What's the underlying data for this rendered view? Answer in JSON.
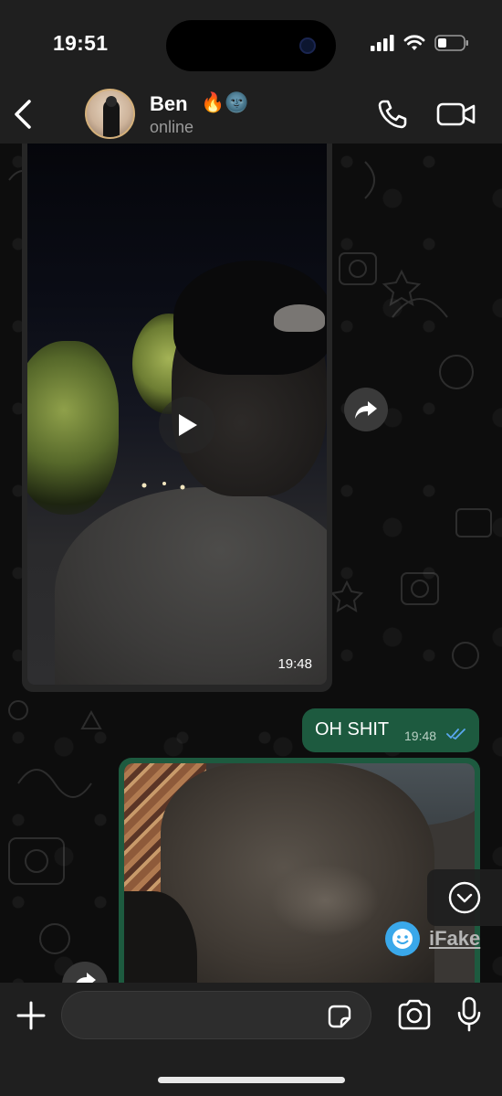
{
  "status_bar": {
    "time": "19:51",
    "icons": [
      "signal-icon",
      "wifi-icon",
      "battery-icon"
    ]
  },
  "header": {
    "back_icon": "chevron-left-icon",
    "contact_name": "Ben",
    "contact_emoji": "🔥🌚",
    "contact_status": "online",
    "call_icon": "phone-icon",
    "video_icon": "video-camera-icon"
  },
  "messages": {
    "incoming_video": {
      "time": "19:48",
      "play_icon": "play-icon",
      "forward_icon": "forward-icon"
    },
    "outgoing_text": {
      "text": "OH SHIT",
      "time": "19:48",
      "status_icon": "double-check-icon"
    },
    "outgoing_image": {
      "forward_icon": "forward-icon"
    }
  },
  "scroll_down_icon": "chevron-down-circle-icon",
  "watermark": {
    "text": "iFake"
  },
  "input_bar": {
    "plus_icon": "plus-icon",
    "placeholder": "",
    "sticker_icon": "sticker-icon",
    "camera_icon": "camera-icon",
    "mic_icon": "microphone-icon"
  },
  "colors": {
    "outgoing_bubble": "#1d5a3f",
    "incoming_bubble": "#262626",
    "read_check": "#5aa7f0",
    "bar_background": "#1f1f1f"
  }
}
